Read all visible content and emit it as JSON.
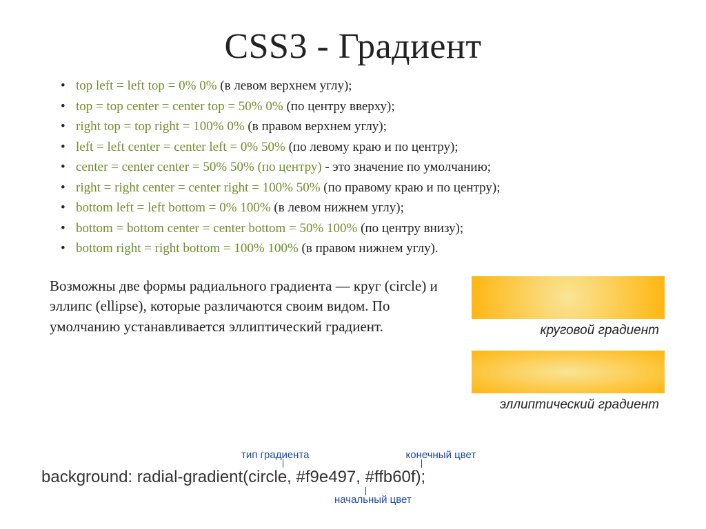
{
  "title": "CSS3 - Градиент",
  "positions": [
    {
      "kw": "top left = left top = 0% 0%",
      "tail": " (в левом верхнем углу);"
    },
    {
      "kw": "top = top center = center top = 50% 0%",
      "tail": " (по центру вверху);"
    },
    {
      "kw": "right top = top right = 100% 0%",
      "tail": " (в правом верхнем углу);"
    },
    {
      "kw": "left = left center = center left = 0% 50%",
      "tail": " (по левому краю и по центру);"
    },
    {
      "kw": "center = center center = 50% 50% (по центру)",
      "tail": " - это значение по умолчанию;"
    },
    {
      "kw": "right = right center = center right = 100% 50%",
      "tail": " (по правому краю и по центру);"
    },
    {
      "kw": "bottom left = left bottom = 0% 100%",
      "tail": " (в левом нижнем углу);"
    },
    {
      "kw": "bottom = bottom center = center bottom = 50% 100%",
      "tail": " (по центру внизу);"
    },
    {
      "kw": "bottom right = right bottom = 100% 100%",
      "tail": " (в правом нижнем углу)."
    }
  ],
  "description": "Возможны две формы радиального градиента — круг (circle) и эллипс (ellipse), которые различаются своим видом. По умолчанию устанавливается эллиптический градиент.",
  "samples": {
    "circle_caption": "круговой градиент",
    "ellipse_caption": "эллиптический градиент"
  },
  "annotations": {
    "type": "тип градиента",
    "end": "конечный цвет",
    "start": "начальный цвет"
  },
  "code": "background: radial-gradient(circle, #f9e497, #ffb60f);",
  "colors": {
    "light": "#f9e497",
    "dark": "#ffb60f",
    "annotation": "#1a4aa8",
    "keyword": "#6f8d2a"
  }
}
